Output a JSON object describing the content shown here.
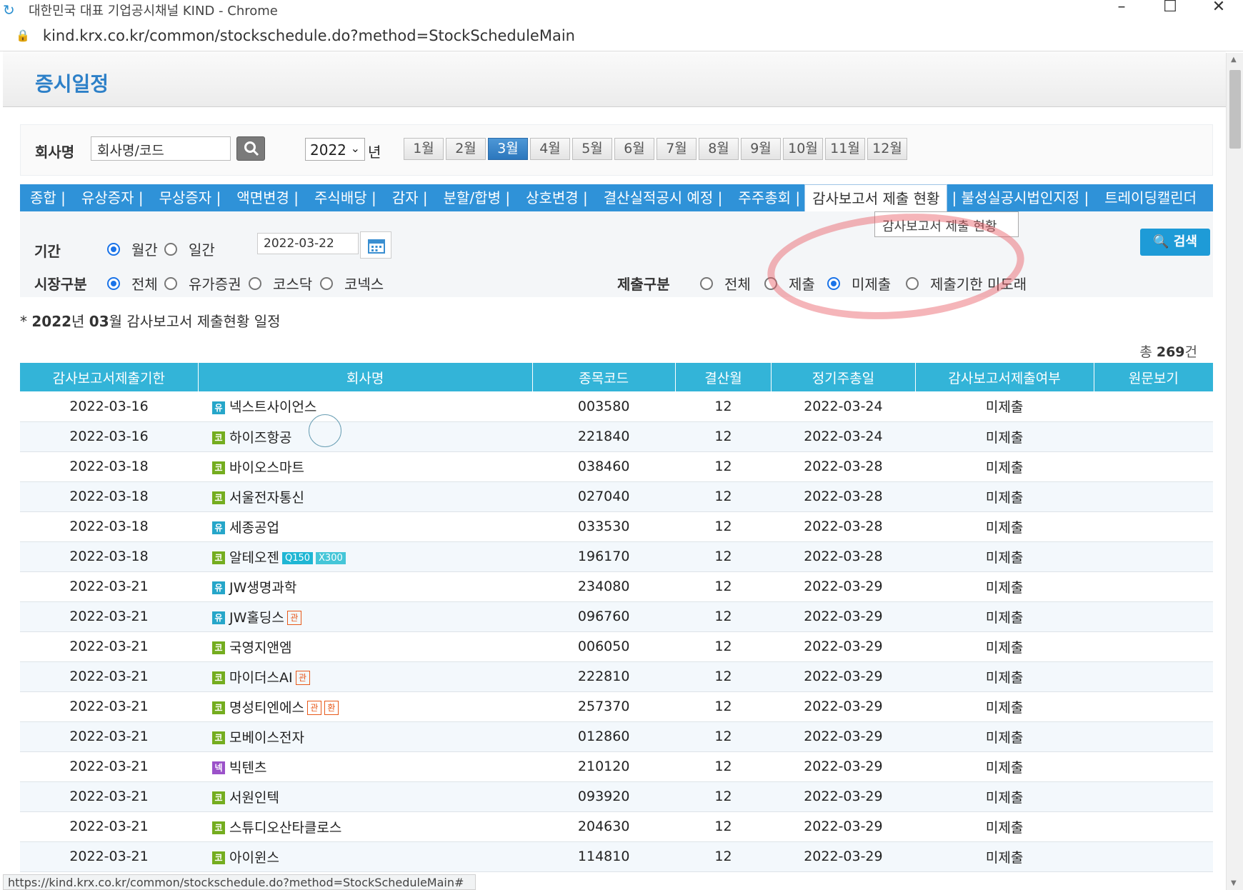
{
  "window": {
    "title": "대한민국 대표 기업공시채널 KIND - Chrome",
    "url": "kind.krx.co.kr/common/stockschedule.do?method=StockScheduleMain"
  },
  "header": {
    "title": "증시일정"
  },
  "search": {
    "company_label": "회사명",
    "company_value": "회사명/코드",
    "year": "2022",
    "year_unit": "년",
    "months": [
      "1월",
      "2월",
      "3월",
      "4월",
      "5월",
      "6월",
      "7월",
      "8월",
      "9월",
      "10월",
      "11월",
      "12월"
    ]
  },
  "tabs": [
    "종합 |",
    "유상증자 |",
    "무상증자 |",
    "액면변경 |",
    "주식배당 |",
    "감자 |",
    "분할/합병 |",
    "상호변경 |",
    "결산실적공시 예정 |",
    "주주총회 |",
    "감사보고서 제출 현황",
    "| 불성실공시법인지정 |",
    "트레이딩캘린더"
  ],
  "tooltip": "감사보고서 제출 현황",
  "filter": {
    "period_label": "기간",
    "monthly": "월간",
    "daily": "일간",
    "date": "2022-03-22",
    "market_label": "시장구분",
    "market_options": [
      "전체",
      "유가증권",
      "코스닥",
      "코넥스"
    ],
    "submit_label": "제출구분",
    "submit_options": [
      "전체",
      "제출",
      "미제출",
      "제출기한 미도래"
    ],
    "search_button": "검색"
  },
  "caption": {
    "prefix": "* ",
    "year": "2022",
    "year_unit": "년 ",
    "month": "03",
    "rest": "월 감사보고서 제출현황 일정"
  },
  "total": {
    "prefix": "총 ",
    "count": "269",
    "suffix": "건"
  },
  "table": {
    "headers": [
      "감사보고서제출기한",
      "회사명",
      "종목코드",
      "결산월",
      "정기주총일",
      "감사보고서제출여부",
      "원문보기"
    ],
    "rows": [
      {
        "deadline": "2022-03-16",
        "market": "유",
        "name": "넥스트사이언스",
        "code": "003580",
        "month": "12",
        "agm": "2022-03-24",
        "status": "미제출"
      },
      {
        "deadline": "2022-03-16",
        "market": "코",
        "name": "하이즈항공",
        "code": "221840",
        "month": "12",
        "agm": "2022-03-24",
        "status": "미제출"
      },
      {
        "deadline": "2022-03-18",
        "market": "코",
        "name": "바이오스마트",
        "code": "038460",
        "month": "12",
        "agm": "2022-03-28",
        "status": "미제출"
      },
      {
        "deadline": "2022-03-18",
        "market": "코",
        "name": "서울전자통신",
        "code": "027040",
        "month": "12",
        "agm": "2022-03-28",
        "status": "미제출"
      },
      {
        "deadline": "2022-03-18",
        "market": "유",
        "name": "세종공업",
        "code": "033530",
        "month": "12",
        "agm": "2022-03-28",
        "status": "미제출"
      },
      {
        "deadline": "2022-03-18",
        "market": "코",
        "name": "알테오젠",
        "code": "196170",
        "month": "12",
        "agm": "2022-03-28",
        "status": "미제출",
        "badges": [
          "Q150",
          "X300"
        ]
      },
      {
        "deadline": "2022-03-21",
        "market": "유",
        "name": "JW생명과학",
        "code": "234080",
        "month": "12",
        "agm": "2022-03-29",
        "status": "미제출"
      },
      {
        "deadline": "2022-03-21",
        "market": "유",
        "name": "JW홀딩스",
        "code": "096760",
        "month": "12",
        "agm": "2022-03-29",
        "status": "미제출",
        "tags": [
          "관"
        ]
      },
      {
        "deadline": "2022-03-21",
        "market": "코",
        "name": "국영지앤엠",
        "code": "006050",
        "month": "12",
        "agm": "2022-03-29",
        "status": "미제출"
      },
      {
        "deadline": "2022-03-21",
        "market": "코",
        "name": "마이더스AI",
        "code": "222810",
        "month": "12",
        "agm": "2022-03-29",
        "status": "미제출",
        "tags": [
          "관"
        ]
      },
      {
        "deadline": "2022-03-21",
        "market": "코",
        "name": "명성티엔에스",
        "code": "257370",
        "month": "12",
        "agm": "2022-03-29",
        "status": "미제출",
        "tags": [
          "관",
          "환"
        ]
      },
      {
        "deadline": "2022-03-21",
        "market": "코",
        "name": "모베이스전자",
        "code": "012860",
        "month": "12",
        "agm": "2022-03-29",
        "status": "미제출"
      },
      {
        "deadline": "2022-03-21",
        "market": "넥",
        "name": "빅텐츠",
        "code": "210120",
        "month": "12",
        "agm": "2022-03-29",
        "status": "미제출"
      },
      {
        "deadline": "2022-03-21",
        "market": "코",
        "name": "서원인텍",
        "code": "093920",
        "month": "12",
        "agm": "2022-03-29",
        "status": "미제출"
      },
      {
        "deadline": "2022-03-21",
        "market": "코",
        "name": "스튜디오산타클로스",
        "code": "204630",
        "month": "12",
        "agm": "2022-03-29",
        "status": "미제출"
      },
      {
        "deadline": "2022-03-21",
        "market": "코",
        "name": "아이윈스",
        "code": "114810",
        "month": "12",
        "agm": "2022-03-29",
        "status": "미제출"
      }
    ]
  },
  "statusbar": "https://kind.krx.co.kr/common/stockschedule.do?method=StockScheduleMain#"
}
